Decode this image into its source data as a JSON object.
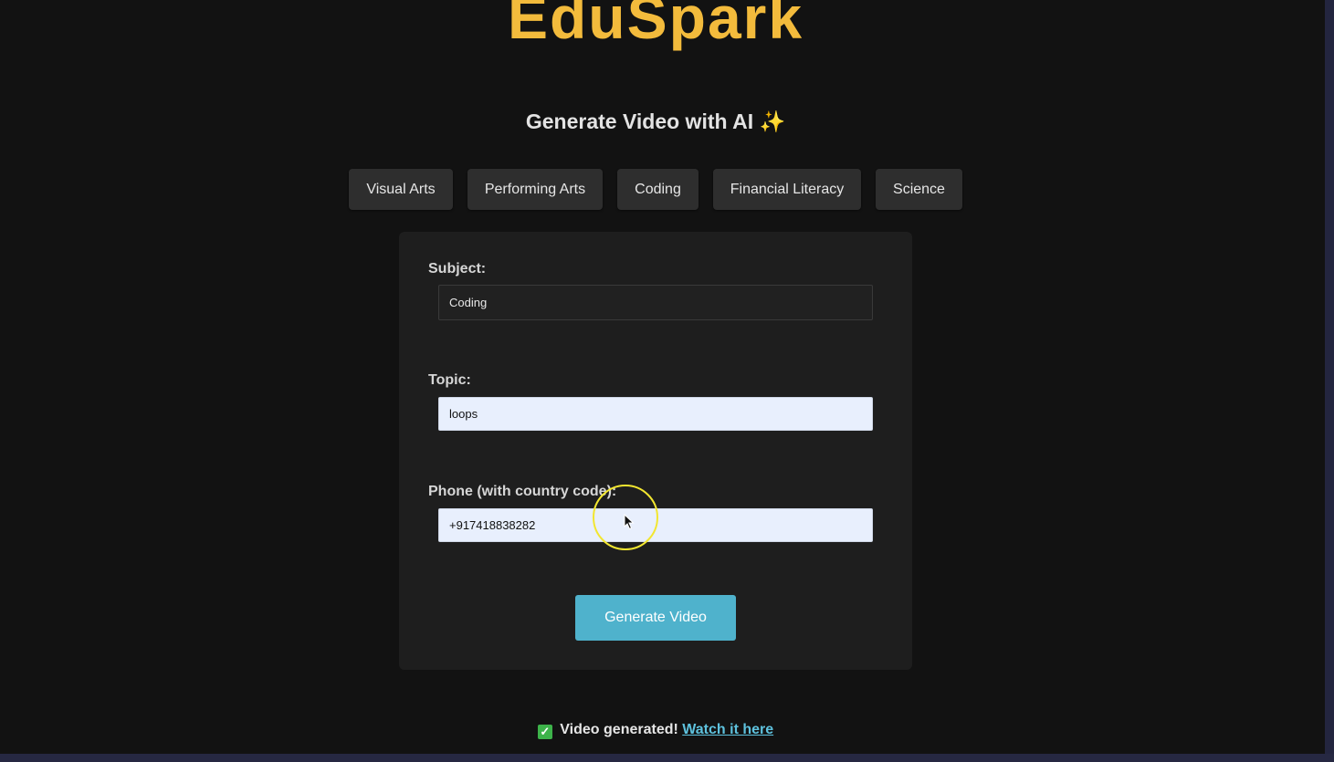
{
  "brand": {
    "name": "EduSpark"
  },
  "header": {
    "title": "Generate Video with AI",
    "sparkle": "✨"
  },
  "categories": [
    "Visual Arts",
    "Performing Arts",
    "Coding",
    "Financial Literacy",
    "Science"
  ],
  "form": {
    "subject_label": "Subject:",
    "subject_value": "Coding",
    "topic_label": "Topic:",
    "topic_value": "loops",
    "phone_label": "Phone (with country code):",
    "phone_value": "+917418838282",
    "submit_label": "Generate Video"
  },
  "result": {
    "check": "✓",
    "message": "Video generated!",
    "link_label": "Watch it here"
  },
  "colors": {
    "brand": "#f3bb3c",
    "accent_button": "#4fb2cc",
    "link": "#5ec2de",
    "cursor_highlight": "#f2e630"
  },
  "icons": {
    "sparkle": "sparkle-icon",
    "check": "check-icon",
    "cursor": "cursor-icon"
  }
}
